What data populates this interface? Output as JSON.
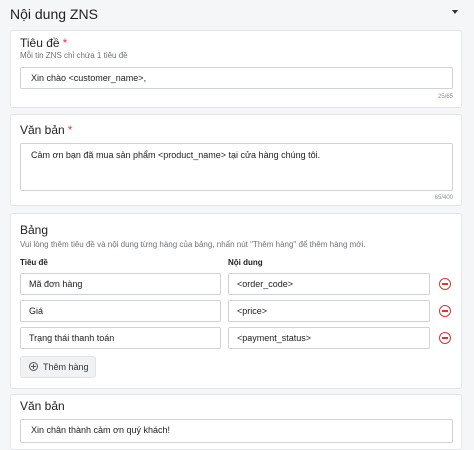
{
  "header": {
    "title": "Nội dung ZNS"
  },
  "title_section": {
    "label": "Tiêu đề",
    "required_mark": "*",
    "hint": "Mỗi tin ZNS chỉ chứa 1 tiêu đề",
    "value": "Xin chào <customer_name>,",
    "counter": "25/65"
  },
  "body_section": {
    "label": "Văn bản",
    "required_mark": "*",
    "value": "Cảm ơn bạn đã mua sản phẩm <product_name> tại cửa hàng chúng tôi.",
    "counter": "65/400"
  },
  "table_section": {
    "label": "Bảng",
    "hint": "Vui lòng thêm tiêu đề và nội dung từng hàng của bảng, nhấn nút \"Thêm hàng\" để thêm hàng mới.",
    "col_title": "Tiêu đề",
    "col_content": "Nội dung",
    "rows": [
      {
        "title": "Mã đơn hàng",
        "content": "<order_code>"
      },
      {
        "title": "Giá",
        "content": "<price>"
      },
      {
        "title": "Trạng thái thanh toán",
        "content": "<payment_status>"
      }
    ],
    "add_row_label": "Thêm hàng"
  },
  "footer_section": {
    "label": "Văn bản",
    "value": "Xin chân thành cảm ơn quý khách!"
  },
  "colors": {
    "required": "#e0403a",
    "remove": "#d23a35",
    "border": "#cfd3d8"
  }
}
